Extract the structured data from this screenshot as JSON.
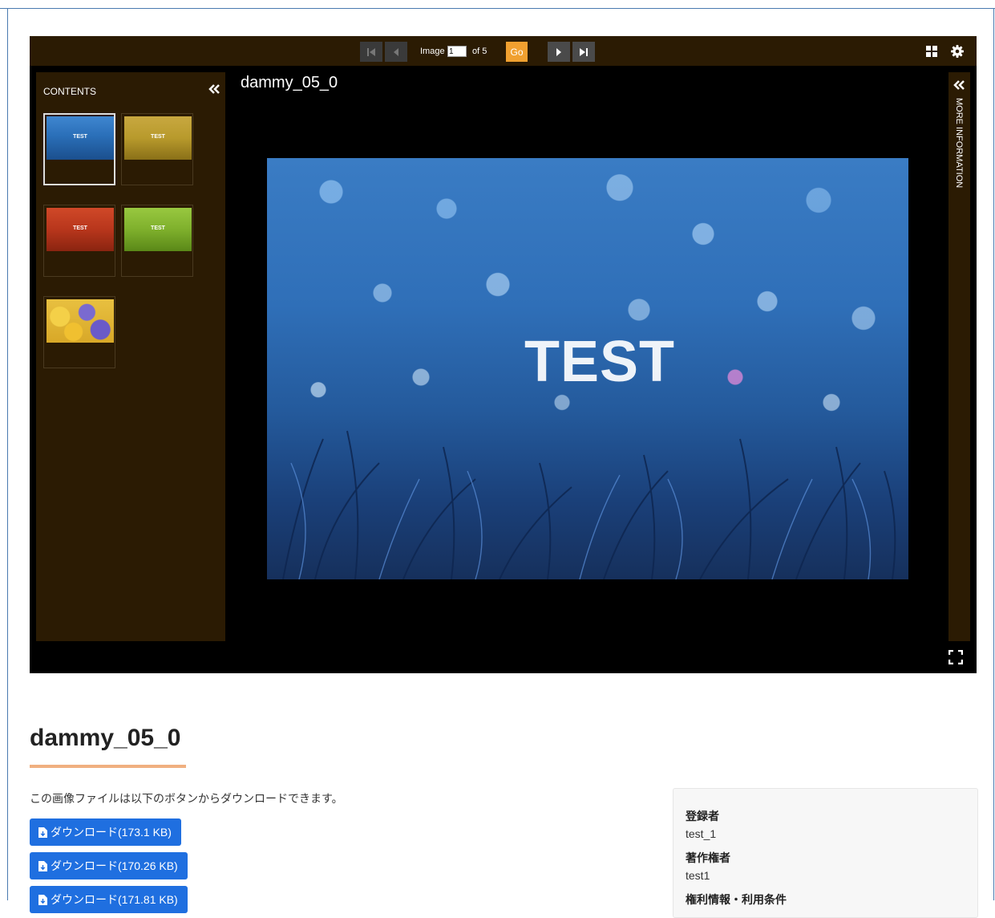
{
  "viewer": {
    "toolbar": {
      "image_label": "Image",
      "page_value": "1",
      "of_label": "of 5",
      "go_label": "Go"
    },
    "contents": {
      "title": "CONTENTS",
      "thumbnails": [
        {
          "text": "TEST",
          "color": "#2a6fb8",
          "active": true
        },
        {
          "text": "TEST",
          "color": "#b89a2c",
          "active": false
        },
        {
          "text": "TEST",
          "color": "#b8361c",
          "active": false
        },
        {
          "text": "TEST",
          "color": "#7fb02c",
          "active": false
        },
        {
          "text": "",
          "color": "#e8c040",
          "active": false
        }
      ]
    },
    "title": "dammy_05_0",
    "image_text": "TEST",
    "more_info_label": "MORE INFORMATION"
  },
  "page": {
    "title": "dammy_05_0",
    "description": "この画像ファイルは以下のボタンからダウンロードできます。",
    "downloads": [
      {
        "label": "ダウンロード(173.1 KB)"
      },
      {
        "label": "ダウンロード(170.26 KB)"
      },
      {
        "label": "ダウンロード(171.81 KB)"
      }
    ],
    "meta": {
      "registrant_label": "登録者",
      "registrant_value": "test_1",
      "copyright_label": "著作権者",
      "copyright_value": "test1",
      "rights_label": "権利情報・利用条件"
    }
  },
  "colors": {
    "toolbar_bg": "#2b1b03",
    "go_button": "#f0a030",
    "download_button": "#1f6fe0",
    "title_underline": "#f0b080"
  }
}
